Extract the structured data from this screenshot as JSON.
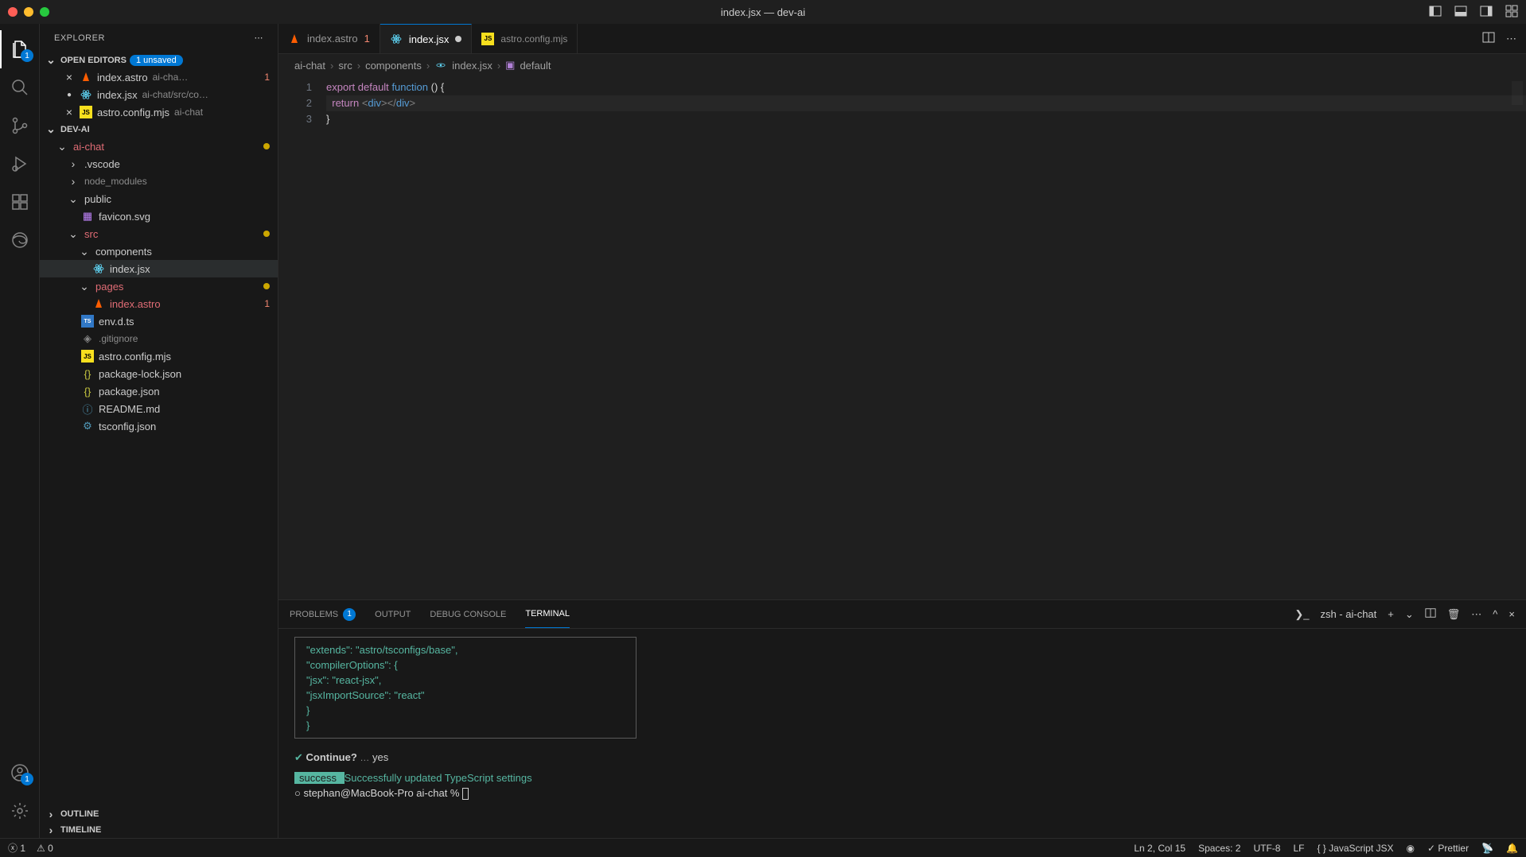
{
  "window_title": "index.jsx — dev-ai",
  "explorer": {
    "title": "EXPLORER",
    "open_editors_label": "OPEN EDITORS",
    "unsaved_badge": "1 unsaved",
    "open_editors": [
      {
        "name": "index.astro",
        "hint": "ai-cha…",
        "err": "1",
        "modified": false
      },
      {
        "name": "index.jsx",
        "hint": "ai-chat/src/co…",
        "err": "",
        "modified": true
      },
      {
        "name": "astro.config.mjs",
        "hint": "ai-chat",
        "err": "",
        "modified": false
      }
    ],
    "project_label": "DEV-AI",
    "tree": {
      "ai_chat": "ai-chat",
      "vscode": ".vscode",
      "node_modules": "node_modules",
      "public": "public",
      "favicon": "favicon.svg",
      "src": "src",
      "components": "components",
      "index_jsx": "index.jsx",
      "pages": "pages",
      "index_astro": "index.astro",
      "index_astro_err": "1",
      "env": "env.d.ts",
      "gitignore": ".gitignore",
      "astro_config": "astro.config.mjs",
      "pkg_lock": "package-lock.json",
      "pkg": "package.json",
      "readme": "README.md",
      "tsconfig": "tsconfig.json"
    },
    "outline": "OUTLINE",
    "timeline": "TIMELINE"
  },
  "tabs": [
    {
      "label": "index.astro",
      "err": "1",
      "active": false,
      "dirty": false,
      "dim": false
    },
    {
      "label": "index.jsx",
      "err": "",
      "active": true,
      "dirty": true,
      "dim": false
    },
    {
      "label": "astro.config.mjs",
      "err": "",
      "active": false,
      "dirty": false,
      "dim": true
    }
  ],
  "breadcrumbs": [
    "ai-chat",
    "src",
    "components",
    "index.jsx",
    "default"
  ],
  "code": {
    "lines": [
      "1",
      "2",
      "3"
    ]
  },
  "panel": {
    "tabs": {
      "problems": "PROBLEMS",
      "problems_count": "1",
      "output": "OUTPUT",
      "debug": "DEBUG CONSOLE",
      "terminal": "TERMINAL"
    },
    "shell": "zsh - ai-chat"
  },
  "terminal": {
    "json1": "  \"extends\": \"astro/tsconfigs/base\",",
    "json2": "  \"compilerOptions\": {",
    "json3": "    \"jsx\": \"react-jsx\",",
    "json4": "    \"jsxImportSource\": \"react\"",
    "json5": "  }",
    "json6": "}",
    "continue_q": "Continue?",
    "continue_dots": "…",
    "continue_a": "yes",
    "success_label": " success ",
    "success_msg": "Successfully updated TypeScript settings",
    "prompt": "stephan@MacBook-Pro ai-chat % "
  },
  "status": {
    "errors": "1",
    "warnings": "0",
    "ln_col": "Ln 2, Col 15",
    "spaces": "Spaces: 2",
    "encoding": "UTF-8",
    "eol": "LF",
    "lang": "JavaScript JSX",
    "prettier": "Prettier"
  },
  "activity_badge": "1",
  "account_badge": "1"
}
